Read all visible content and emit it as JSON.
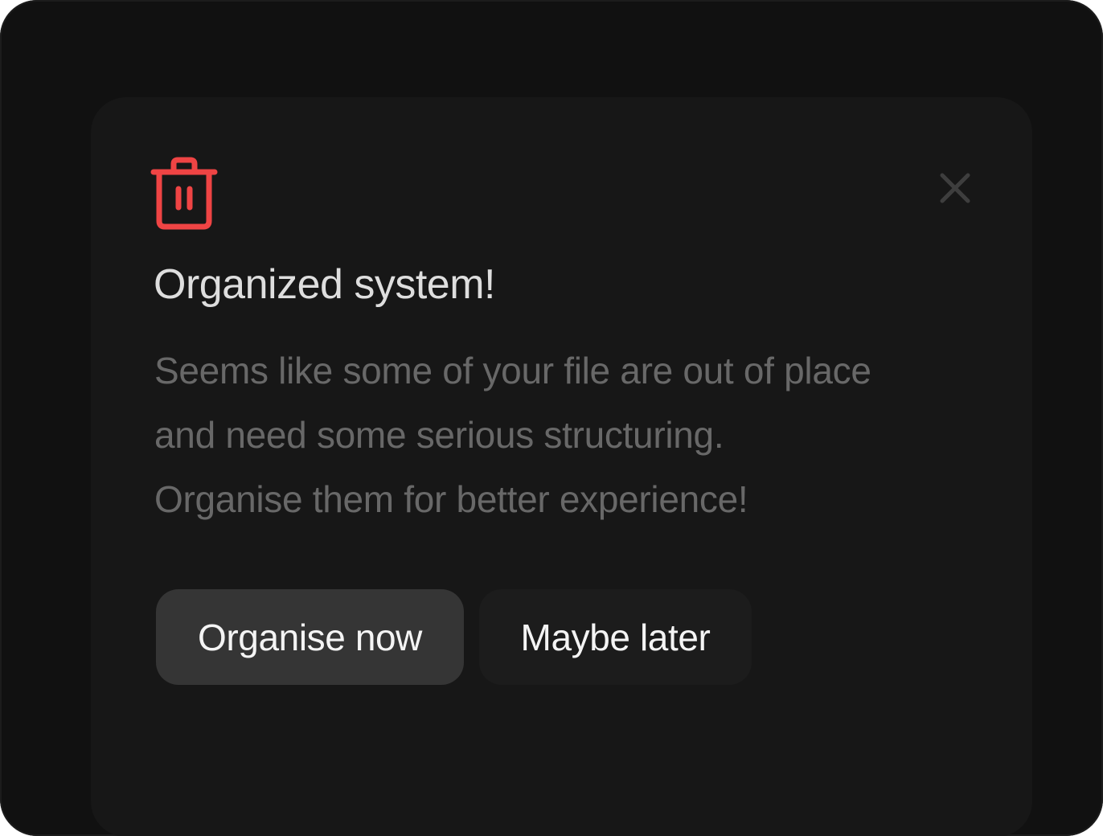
{
  "dialog": {
    "title": "Organized system!",
    "description_lines": [
      "Seems like some of your file are out of place",
      "and need some serious structuring.",
      "Organise them for better experience!"
    ],
    "icon": "trash-icon",
    "close_icon": "close-icon",
    "primary_label": "Organise now",
    "secondary_label": "Maybe later"
  },
  "colors": {
    "accent_red": "#ef4444",
    "background": "#111111",
    "card": "#171717",
    "primary_button": "#353535",
    "secondary_button": "#1c1c1c"
  }
}
